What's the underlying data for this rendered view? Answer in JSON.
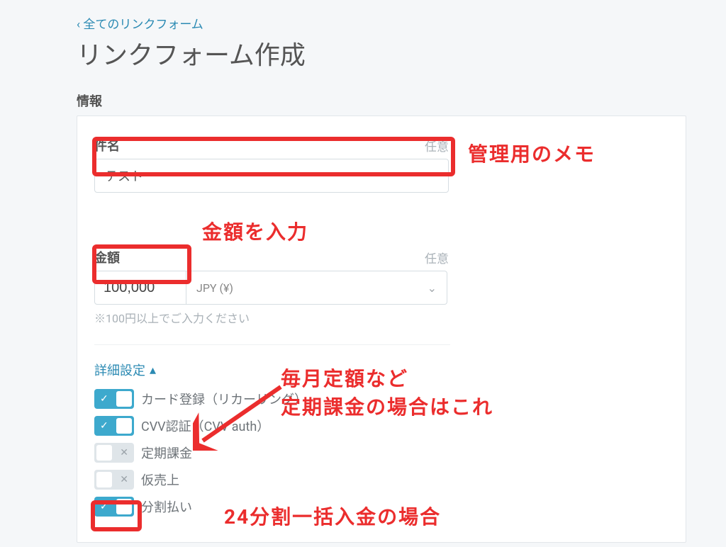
{
  "breadcrumb": {
    "back_label": "‹ 全てのリンクフォーム"
  },
  "page": {
    "title": "リンクフォーム作成"
  },
  "section": {
    "info_title": "情報"
  },
  "form": {
    "subject": {
      "label": "件名",
      "optional": "任意",
      "value": "テスト"
    },
    "amount": {
      "label": "金額",
      "optional": "任意",
      "value": "100,000",
      "currency_display": "JPY (¥)",
      "helper": "※100円以上でご入力ください"
    },
    "advanced": {
      "toggle_label": "詳細設定",
      "caret": "▴",
      "items": [
        {
          "label": "カード登録（リカーリング）",
          "on": true
        },
        {
          "label": "CVV認証（CVV auth）",
          "on": true
        },
        {
          "label": "定期課金",
          "on": false
        },
        {
          "label": "仮売上",
          "on": false
        },
        {
          "label": "分割払い",
          "on": true
        }
      ]
    }
  },
  "annotations": {
    "subject_note": "管理用のメモ",
    "amount_note": "金額を入力",
    "recurring_note_line1": "毎月定額など",
    "recurring_note_line2": "定期課金の場合はこれ",
    "installment_note": "24分割一括入金の場合"
  },
  "icons": {
    "check": "✓",
    "x": "✕",
    "chevron_down": "⌄"
  }
}
